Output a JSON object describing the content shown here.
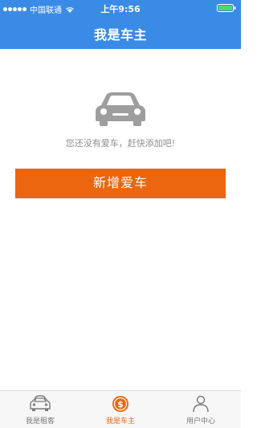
{
  "status_bar": {
    "carrier": "中国联通",
    "time": "上午9:56"
  },
  "header": {
    "title": "我是车主"
  },
  "empty_state": {
    "icon": "car-icon",
    "message": "您还没有爱车，赶快添加吧!"
  },
  "actions": {
    "add_car_label": "新增爱车"
  },
  "tab_bar": {
    "items": [
      {
        "label": "我是租客",
        "icon": "car-outline-icon",
        "active": false
      },
      {
        "label": "我是车主",
        "icon": "dollar-coin-icon",
        "active": true
      },
      {
        "label": "用户中心",
        "icon": "user-icon",
        "active": false
      }
    ]
  },
  "colors": {
    "header": "#3a8be6",
    "accent": "#ec650f",
    "tab_inactive": "#777777"
  }
}
